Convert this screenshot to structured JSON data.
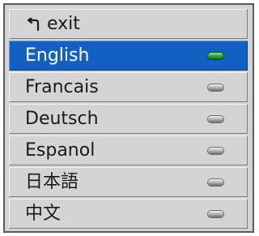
{
  "menu": {
    "exit_label": "exit",
    "exit_icon": "return-arrow-icon",
    "languages": [
      {
        "label": "English",
        "selected": true,
        "indicator": "on"
      },
      {
        "label": "Francais",
        "selected": false,
        "indicator": "off"
      },
      {
        "label": "Deutsch",
        "selected": false,
        "indicator": "off"
      },
      {
        "label": "Espanol",
        "selected": false,
        "indicator": "off"
      },
      {
        "label": "日本語",
        "selected": false,
        "indicator": "off"
      },
      {
        "label": "中文",
        "selected": false,
        "indicator": "off"
      }
    ]
  },
  "colors": {
    "selected_row": "#1261c2",
    "row": "#d4d4d4",
    "indicator_on": "#2db23a",
    "indicator_off": "#b8b8b8"
  }
}
